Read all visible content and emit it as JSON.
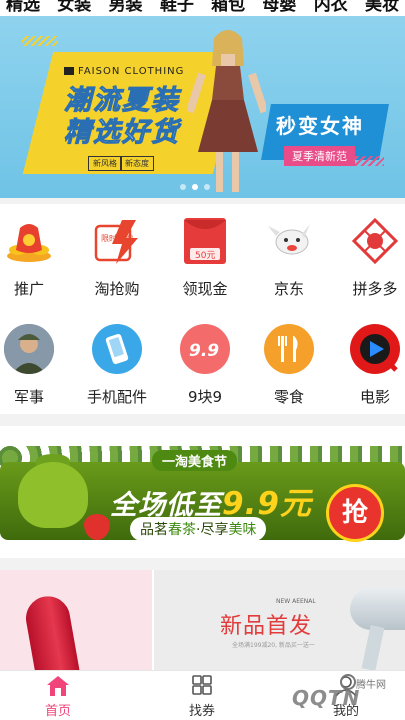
{
  "top_tabs": [
    "精选",
    "女装",
    "男装",
    "鞋子",
    "箱包",
    "母婴",
    "内衣",
    "美妆"
  ],
  "banner": {
    "brand": "FAISON CLOTHING",
    "title_line1": "潮流夏装",
    "title_line2": "精选好货",
    "tag_a": "新风格",
    "tag_b": "新态度",
    "goddess": "秒变女神",
    "summer": "夏季清新范",
    "page_count": 3,
    "active_page": 2
  },
  "categories": [
    {
      "label": "推广",
      "icon": "money-bag-icon"
    },
    {
      "label": "淘抢购",
      "icon": "flash-sale-icon"
    },
    {
      "label": "领现金",
      "icon": "red-envelope-icon"
    },
    {
      "label": "京东",
      "icon": "jd-dog-icon"
    },
    {
      "label": "拼多多",
      "icon": "pinduoduo-icon"
    },
    {
      "label": "军事",
      "icon": "soldier-icon"
    },
    {
      "label": "手机配件",
      "icon": "phone-accessory-icon"
    },
    {
      "label": "9块9",
      "icon": "nine-nine-icon"
    },
    {
      "label": "零食",
      "icon": "fork-knife-icon"
    },
    {
      "label": "电影",
      "icon": "movie-play-icon"
    }
  ],
  "category_icon_texts": {
    "flash": "限时抢购",
    "envelope": "50元",
    "nine": "9.9"
  },
  "promo": {
    "festival": "一淘美食节",
    "main_prefix": "全场低至",
    "main_highlight": "9.9元",
    "sub_a": "品茗",
    "sub_b": "春茶",
    "sub_c": "·尽享",
    "sub_d": "美味",
    "grab": "抢"
  },
  "tiles": {
    "right_eng": "NEW AEENAL",
    "right_title": "新品首发",
    "right_line": "全场满199减20, 新品买一送一"
  },
  "tabbar": {
    "home": "首页",
    "coupon": "找券",
    "mine": "我的"
  },
  "watermark": {
    "text": "QQTN",
    "small": "腾牛网"
  },
  "colors": {
    "accent": "#f0447a",
    "banner_blue": "#6fc3e6",
    "banner_yellow": "#f5d22b",
    "promo_green": "#4e8a12"
  }
}
